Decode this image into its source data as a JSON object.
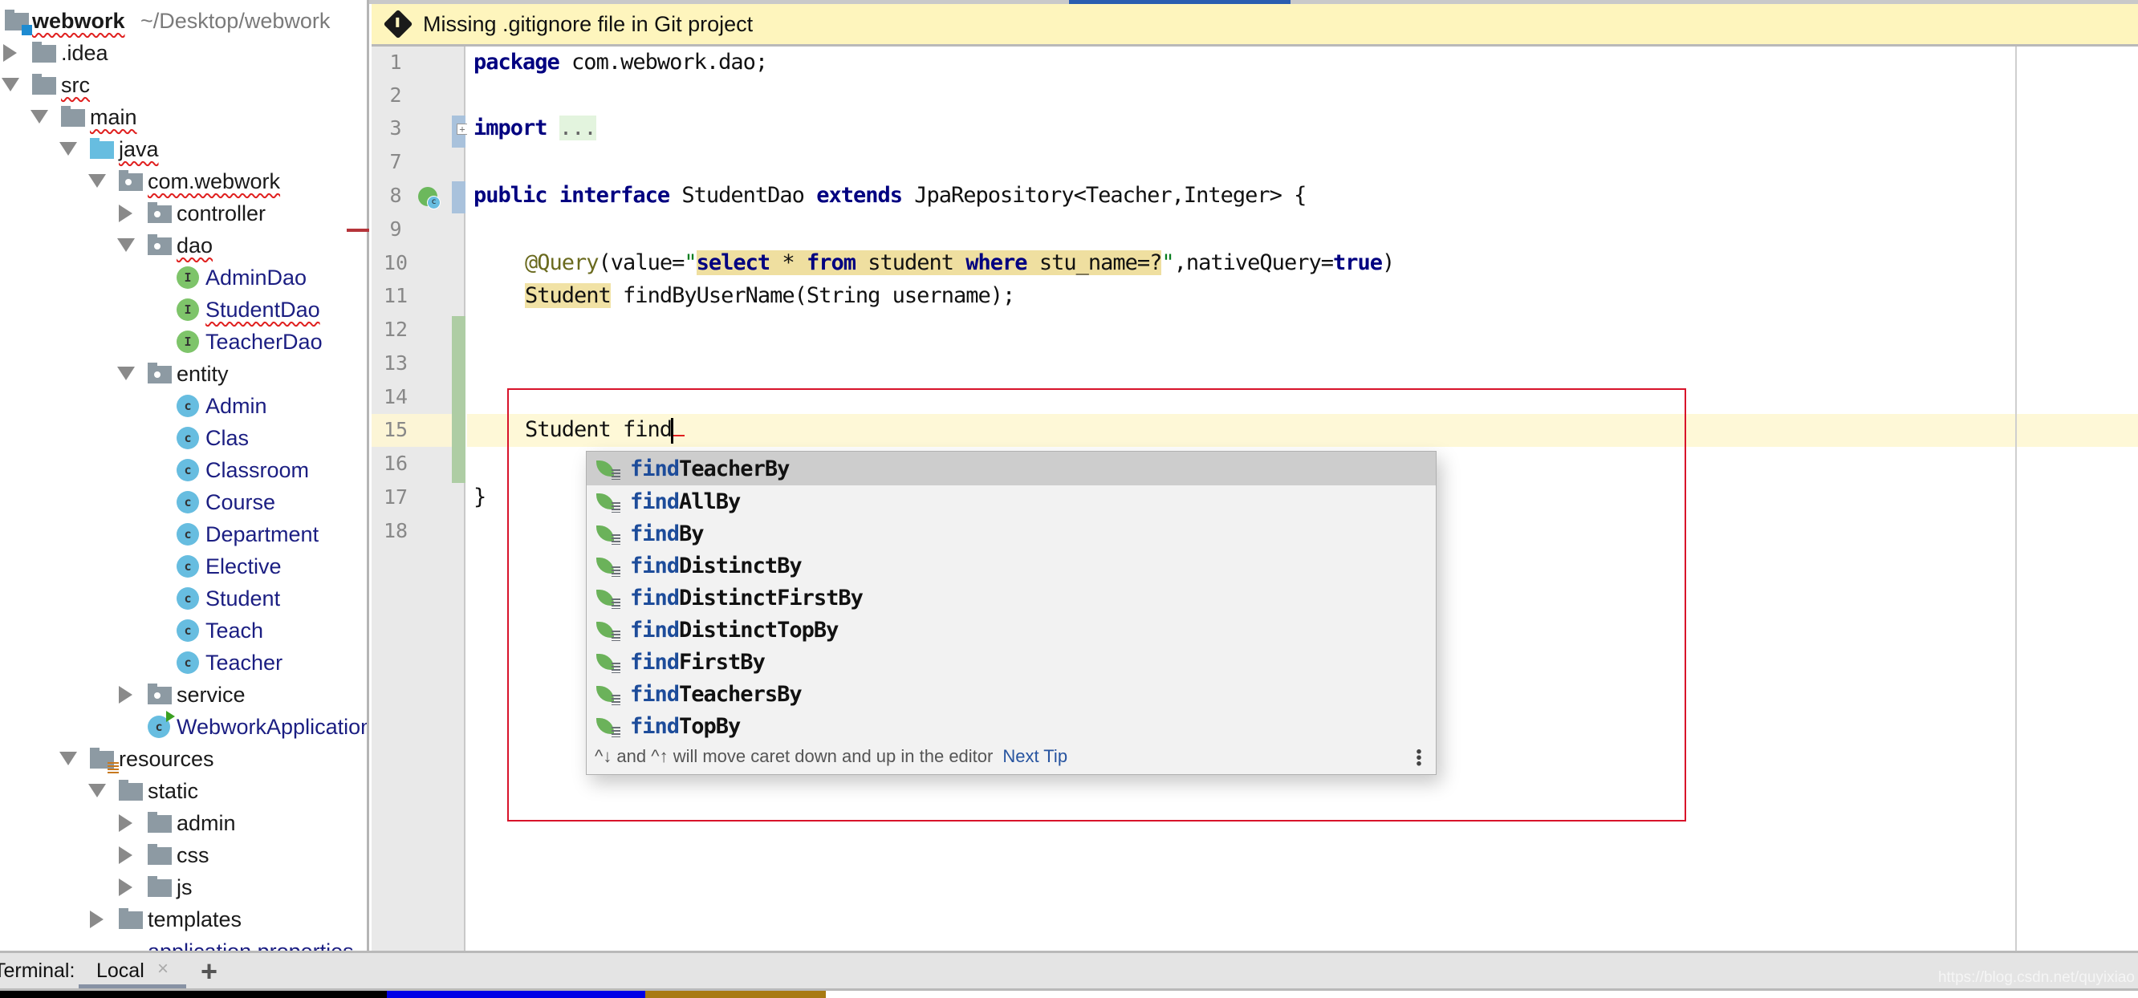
{
  "project": {
    "root_name": "webwork",
    "root_path": "~/Desktop/webwork",
    "tree": [
      {
        "label": "webwork",
        "kind": "root",
        "expanded": true
      },
      {
        "label": ".idea",
        "kind": "folder",
        "expanded": false
      },
      {
        "label": "src",
        "kind": "folder",
        "expanded": true
      },
      {
        "label": "main",
        "kind": "folder",
        "expanded": true
      },
      {
        "label": "java",
        "kind": "source-folder",
        "expanded": true
      },
      {
        "label": "com.webwork",
        "kind": "package",
        "expanded": true
      },
      {
        "label": "controller",
        "kind": "package",
        "expanded": false
      },
      {
        "label": "dao",
        "kind": "package",
        "expanded": true
      },
      {
        "label": "AdminDao",
        "kind": "interface"
      },
      {
        "label": "StudentDao",
        "kind": "interface"
      },
      {
        "label": "TeacherDao",
        "kind": "interface"
      },
      {
        "label": "entity",
        "kind": "package",
        "expanded": true
      },
      {
        "label": "Admin",
        "kind": "class"
      },
      {
        "label": "Clas",
        "kind": "class"
      },
      {
        "label": "Classroom",
        "kind": "class"
      },
      {
        "label": "Course",
        "kind": "class"
      },
      {
        "label": "Department",
        "kind": "class"
      },
      {
        "label": "Elective",
        "kind": "class"
      },
      {
        "label": "Student",
        "kind": "class"
      },
      {
        "label": "Teach",
        "kind": "class"
      },
      {
        "label": "Teacher",
        "kind": "class"
      },
      {
        "label": "service",
        "kind": "package",
        "expanded": false
      },
      {
        "label": "WebworkApplication",
        "kind": "spring-app-class"
      },
      {
        "label": "resources",
        "kind": "resources-folder",
        "expanded": true
      },
      {
        "label": "static",
        "kind": "folder",
        "expanded": true
      },
      {
        "label": "admin",
        "kind": "folder",
        "expanded": false
      },
      {
        "label": "css",
        "kind": "folder",
        "expanded": false
      },
      {
        "label": "js",
        "kind": "folder",
        "expanded": false
      },
      {
        "label": "templates",
        "kind": "folder",
        "expanded": false
      },
      {
        "label": "application.properties",
        "kind": "properties-file"
      }
    ]
  },
  "banner": {
    "icon": "git-icon",
    "text": "Missing .gitignore file in Git project"
  },
  "editor": {
    "line_numbers": [
      "1",
      "2",
      "3",
      "7",
      "8",
      "9",
      "10",
      "11",
      "12",
      "13",
      "14",
      "15",
      "16",
      "17",
      "18"
    ],
    "current_line": "15",
    "lines": {
      "l1_kw": "package",
      "l1_rest": " com.webwork.dao;",
      "l3_kw": "import",
      "l3_fold": "...",
      "l8_kw1": "public",
      "l8_kw2": "interface",
      "l8_name": " StudentDao ",
      "l8_kw3": "extends",
      "l8_rest": " JpaRepository<Teacher,Integer> {",
      "l10_ann": "@Query",
      "l10_open": "(value=",
      "l10_q1": "\"",
      "l10_sql_kw1": "select",
      "l10_sql_1": " * ",
      "l10_sql_kw2": "from",
      "l10_sql_2": " student ",
      "l10_sql_kw3": "where",
      "l10_sql_3": " stu_name=?",
      "l10_q2": "\"",
      "l10_mid": ",nativeQuery=",
      "l10_kw_true": "true",
      "l10_close": ")",
      "l11_type": "Student",
      "l11_rest": " findByUserName(String username);",
      "l15_text": "Student find",
      "l17_text": "}"
    }
  },
  "completion": {
    "typed_prefix": "find",
    "items": [
      {
        "prefix": "find",
        "suffix": "TeacherBy",
        "selected": true
      },
      {
        "prefix": "find",
        "suffix": "AllBy"
      },
      {
        "prefix": "find",
        "suffix": "By"
      },
      {
        "prefix": "find",
        "suffix": "DistinctBy"
      },
      {
        "prefix": "find",
        "suffix": "DistinctFirstBy"
      },
      {
        "prefix": "find",
        "suffix": "DistinctTopBy"
      },
      {
        "prefix": "find",
        "suffix": "FirstBy"
      },
      {
        "prefix": "find",
        "suffix": "TeachersBy"
      },
      {
        "prefix": "find",
        "suffix": "TopBy"
      }
    ],
    "tip": "^↓ and ^↑ will move caret down and up in the editor",
    "next_tip_label": "Next Tip"
  },
  "bottom_bar": {
    "terminal_label": "Terminal:",
    "tab_label": "Local",
    "close_glyph": "×",
    "add_glyph": "+",
    "watermark": "https://blog.csdn.net/quyixiao"
  },
  "colors": {
    "banner_bg": "#fef5bd",
    "keyword": "#000080",
    "match_highlight": "#1d4c9a",
    "annotation_box": "#d8132a",
    "status_segments": [
      "#000000",
      "#0000e6",
      "#a87a12"
    ]
  }
}
